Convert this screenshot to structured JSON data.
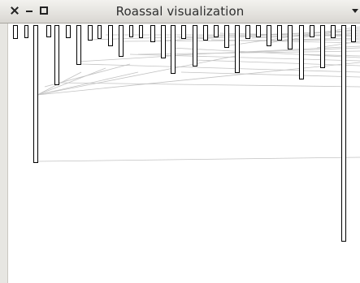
{
  "window": {
    "title": "Roassal visualization"
  },
  "titlebar_buttons": {
    "close": {
      "icon": "close-icon",
      "glyph": "×"
    },
    "minimize": {
      "icon": "minimize-icon"
    },
    "maximize": {
      "icon": "maximize-icon"
    },
    "menu": {
      "icon": "window-menu-icon"
    }
  },
  "colors": {
    "edge": "#c2c2c2",
    "node_stroke": "#000000",
    "node_fill": "#ffffff"
  }
}
